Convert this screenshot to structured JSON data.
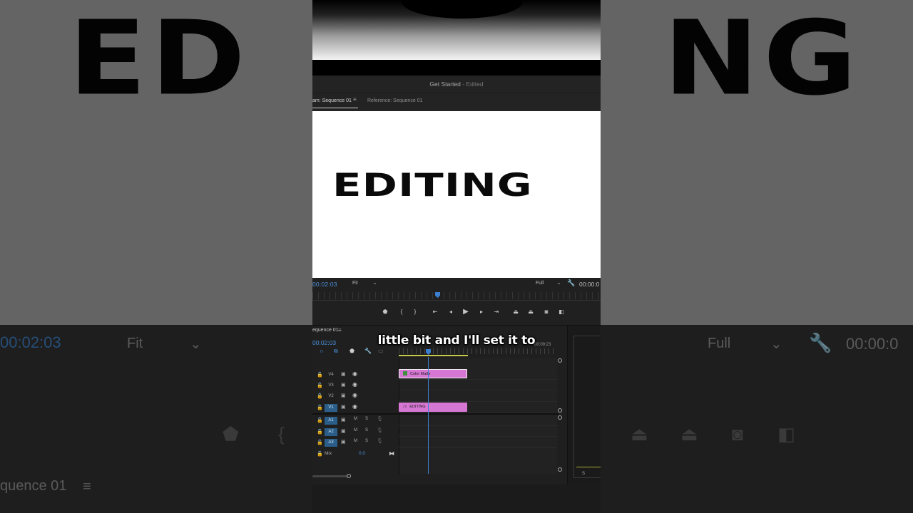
{
  "window": {
    "title": "Get Started",
    "title_suffix": "- Edited"
  },
  "program_monitor": {
    "tabs": [
      {
        "label": "am: Sequence 01",
        "active": true
      },
      {
        "label": "Reference: Sequence 01",
        "active": false
      }
    ],
    "video_text": "EDITING",
    "current_timecode": "00:02:03",
    "fit_option": "Fit",
    "resolution_option": "Full",
    "duration_timecode": "00:00:0"
  },
  "timeline": {
    "sequence_name": "equence 01",
    "timecode": "00:02:03",
    "ruler_end_timecode": "00:09:23",
    "tracks": [
      {
        "name": "V4",
        "kind": "video",
        "active": false
      },
      {
        "name": "V3",
        "kind": "video",
        "active": false
      },
      {
        "name": "V2",
        "kind": "video",
        "active": false
      },
      {
        "name": "V1",
        "kind": "video",
        "active": true
      },
      {
        "name": "A1",
        "kind": "audio",
        "active": true
      },
      {
        "name": "A2",
        "kind": "audio",
        "active": true
      },
      {
        "name": "A3",
        "kind": "audio",
        "active": true
      }
    ],
    "audio_toggles": {
      "mute": "M",
      "solo": "S"
    },
    "clips": [
      {
        "name": "Color Matte",
        "track": "V4",
        "color": "#d777d4"
      },
      {
        "name": "EDITING",
        "track": "V1",
        "color": "#d777d4"
      }
    ],
    "mix": {
      "label": "Mix",
      "value": "0.0"
    },
    "meter_label": "S"
  },
  "caption": "little bit and I'll set it to",
  "background": {
    "word": "ED",
    "word_right": "NG",
    "timecode": "00:02:03",
    "fit_option": "Fit",
    "resolution_option": "Full",
    "duration_timecode": "00:00:0",
    "sequence_name": "quence 01"
  },
  "colors": {
    "accent": "#4a90d9",
    "clip": "#d777d4",
    "inout": "#c8c84a"
  }
}
